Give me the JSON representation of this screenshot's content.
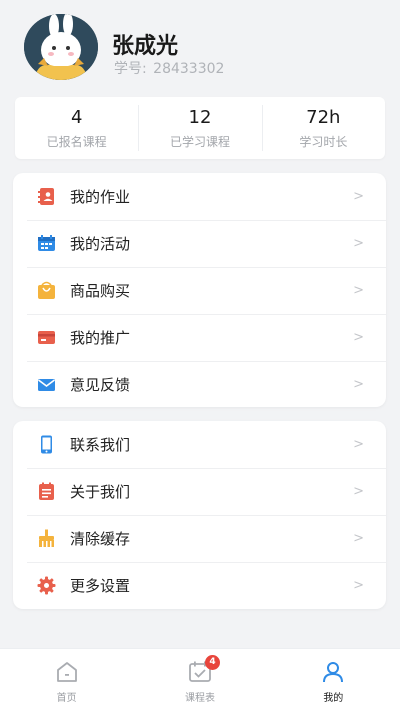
{
  "profile": {
    "name": "张成光",
    "student_id_label": "学号:",
    "student_id": "28433302"
  },
  "stats": [
    {
      "value": "4",
      "label": "已报名课程"
    },
    {
      "value": "12",
      "label": "已学习课程"
    },
    {
      "value": "72h",
      "label": "学习时长"
    }
  ],
  "menu_primary": [
    {
      "label": "我的作业",
      "icon": "homework-icon",
      "color": "#e8604c"
    },
    {
      "label": "我的活动",
      "icon": "calendar-icon",
      "color": "#2f8be6"
    },
    {
      "label": "商品购买",
      "icon": "shopping-bag-icon",
      "color": "#f4b33c"
    },
    {
      "label": "我的推广",
      "icon": "card-icon",
      "color": "#e8604c"
    },
    {
      "label": "意见反馈",
      "icon": "mail-icon",
      "color": "#2f8be6"
    }
  ],
  "menu_secondary": [
    {
      "label": "联系我们",
      "icon": "phone-icon",
      "color": "#2f8be6"
    },
    {
      "label": "关于我们",
      "icon": "notepad-icon",
      "color": "#e8604c"
    },
    {
      "label": "清除缓存",
      "icon": "broom-icon",
      "color": "#f4b33c"
    },
    {
      "label": "更多设置",
      "icon": "gear-icon",
      "color": "#e8604c"
    }
  ],
  "chevron": ">",
  "tabs": [
    {
      "label": "首页",
      "icon": "home-icon",
      "active": false
    },
    {
      "label": "课程表",
      "icon": "schedule-icon",
      "active": false,
      "badge": "4"
    },
    {
      "label": "我的",
      "icon": "user-icon",
      "active": true
    }
  ],
  "colors": {
    "accent_blue": "#2f8be6",
    "accent_red": "#e8604c",
    "accent_yellow": "#f4b33c",
    "badge_red": "#e8453c"
  }
}
